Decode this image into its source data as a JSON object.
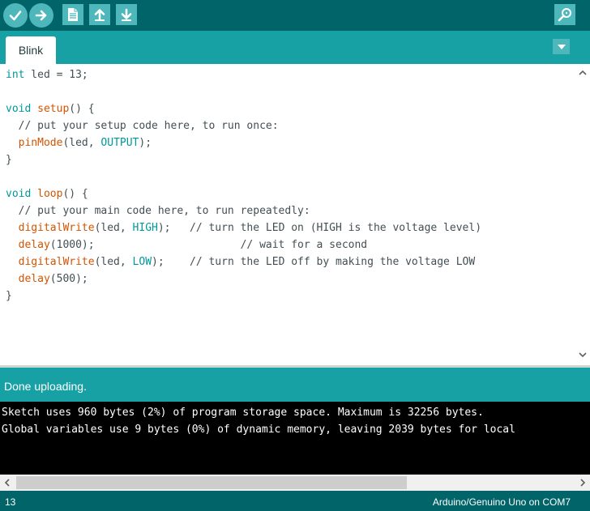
{
  "toolbar": {
    "buttons": [
      {
        "name": "verify-button",
        "icon": "checkmark-icon"
      },
      {
        "name": "upload-button",
        "icon": "arrow-right-icon"
      },
      {
        "name": "new-button",
        "icon": "document-icon"
      },
      {
        "name": "open-button",
        "icon": "arrow-up-icon"
      },
      {
        "name": "save-button",
        "icon": "arrow-down-icon"
      },
      {
        "name": "serial-monitor-button",
        "icon": "magnifier-icon"
      }
    ]
  },
  "tabs": [
    {
      "label": "Blink"
    }
  ],
  "code": {
    "line1": {
      "kw": "int",
      "rest": " led = 13;"
    },
    "setup": {
      "kw": "void",
      "fn": "setup",
      "rest": "() {"
    },
    "setup_comment": "  // put your setup code here, to run once:",
    "pinmode": {
      "indent": "  ",
      "fn": "pinMode",
      "a": "(led, ",
      "const": "OUTPUT",
      "b": ");"
    },
    "close1": "}",
    "loop": {
      "kw": "void",
      "fn": "loop",
      "rest": "() {"
    },
    "loop_comment": "  // put your main code here, to run repeatedly:",
    "dw_high": {
      "indent": "  ",
      "fn": "digitalWrite",
      "a": "(led, ",
      "const": "HIGH",
      "b": ");   // turn the LED on (HIGH is the voltage level)"
    },
    "delay1000": {
      "indent": "  ",
      "fn": "delay",
      "rest": "(1000);                       // wait for a second"
    },
    "dw_low": {
      "indent": "  ",
      "fn": "digitalWrite",
      "a": "(led, ",
      "const": "LOW",
      "b": ");    // turn the LED off by making the voltage LOW"
    },
    "delay500": {
      "indent": "  ",
      "fn": "delay",
      "rest": "(500);"
    },
    "close2": "}"
  },
  "status": {
    "message": "Done uploading."
  },
  "console": {
    "lines": [
      "Sketch uses 960 bytes (2%) of program storage space. Maximum is 32256 bytes.",
      "Global variables use 9 bytes (0%) of dynamic memory, leaving 2039 bytes for local"
    ]
  },
  "footer": {
    "line_number": "13",
    "board": "Arduino/Genuino Uno on COM7"
  },
  "colors": {
    "toolbar_bg": "#006468",
    "accent": "#17a1a5",
    "button_bg": "#4db7bb",
    "keyword": "#00979c",
    "function": "#d35400"
  }
}
